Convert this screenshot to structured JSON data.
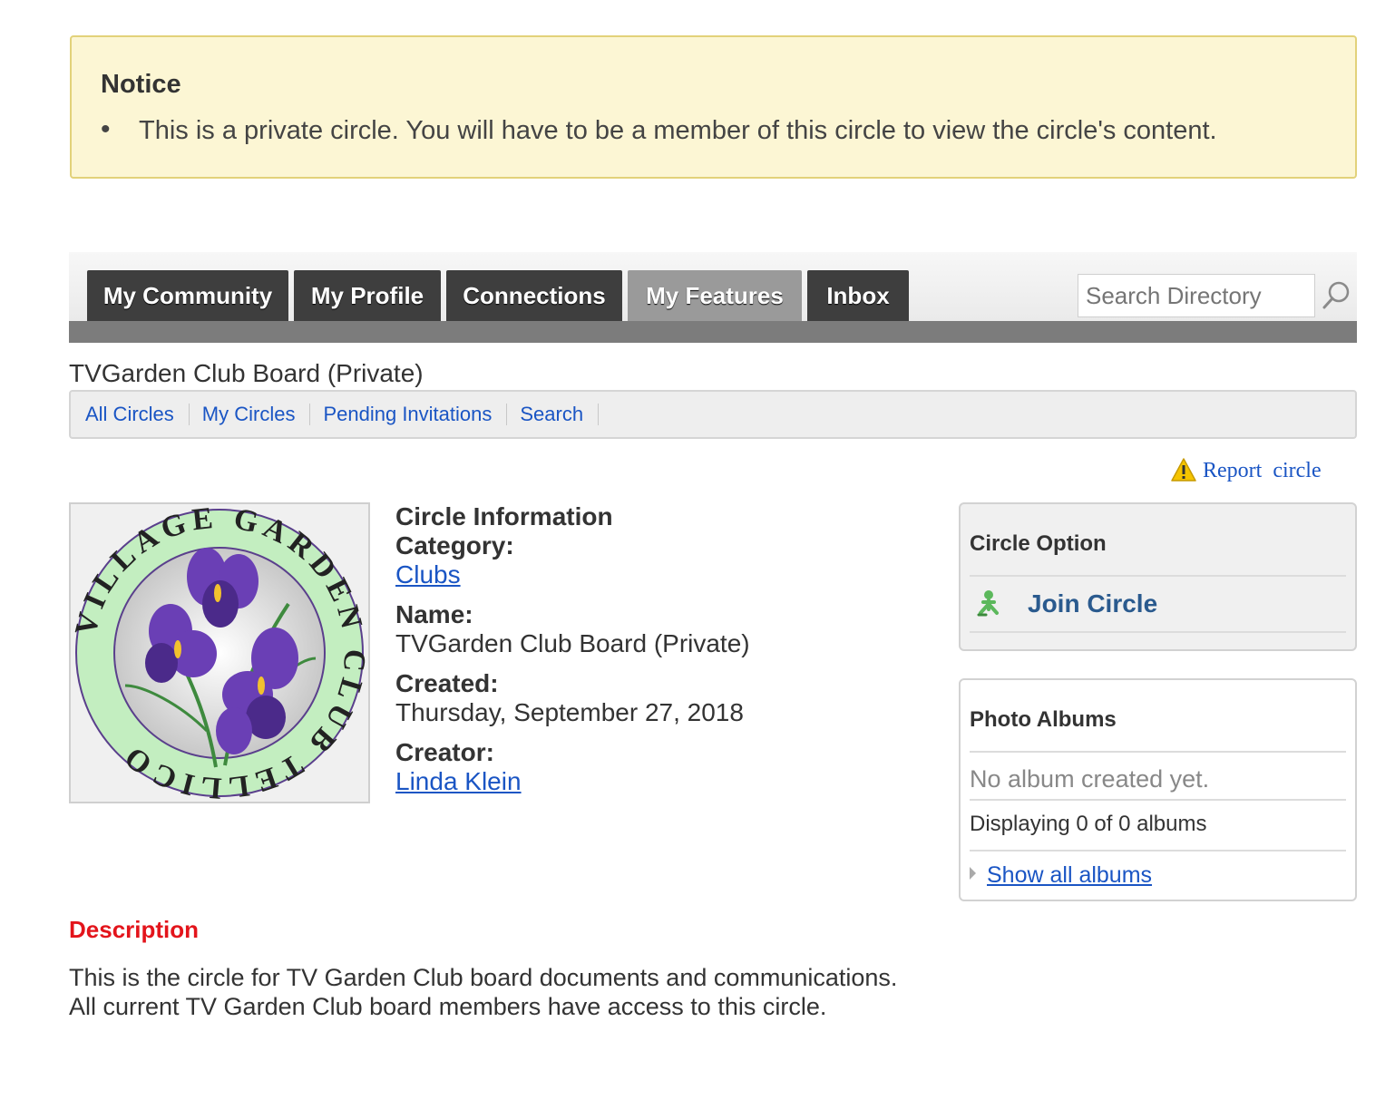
{
  "notice": {
    "title": "Notice",
    "message": "This is a private circle. You will have to be a member of this circle to view the circle's content."
  },
  "nav": {
    "tabs": [
      {
        "label": "My Community"
      },
      {
        "label": "My Profile"
      },
      {
        "label": "Connections"
      },
      {
        "label": "My Features",
        "active": true
      },
      {
        "label": "Inbox"
      }
    ],
    "search_placeholder": "Search Directory"
  },
  "page_title": "TVGarden Club Board (Private)",
  "subnav": {
    "items": [
      {
        "label": "All Circles"
      },
      {
        "label": "My Circles"
      },
      {
        "label": "Pending Invitations"
      },
      {
        "label": "Search"
      }
    ]
  },
  "report_label": "Report  circle",
  "logo": {
    "alt": "Tellico Village Garden Club logo",
    "ring_text": "VILLAGE GARDEN CLUB TELLICO"
  },
  "circle_info": {
    "heading": "Circle Information",
    "category_label": "Category:",
    "category_value": "Clubs",
    "name_label": "Name:",
    "name_value": "TVGarden Club Board (Private)",
    "created_label": "Created:",
    "created_value": "Thursday, September 27, 2018",
    "creator_label": "Creator:",
    "creator_value": "Linda Klein"
  },
  "circle_option": {
    "title": "Circle Option",
    "join_label": "Join Circle"
  },
  "photo_albums": {
    "title": "Photo Albums",
    "empty_text": "No album created yet.",
    "count_text": "Displaying 0 of 0 albums",
    "show_all": "Show all albums"
  },
  "description": {
    "title": "Description",
    "line1": "This is the circle for TV Garden Club board documents and communications.",
    "line2": "All current TV Garden Club board members have access to this circle."
  },
  "colors": {
    "notice_bg": "#fcf6d4",
    "tab_dark": "#3e3e3e",
    "tab_active": "#9a9a9a",
    "link": "#1a55c4",
    "description_title": "#e3141b"
  }
}
